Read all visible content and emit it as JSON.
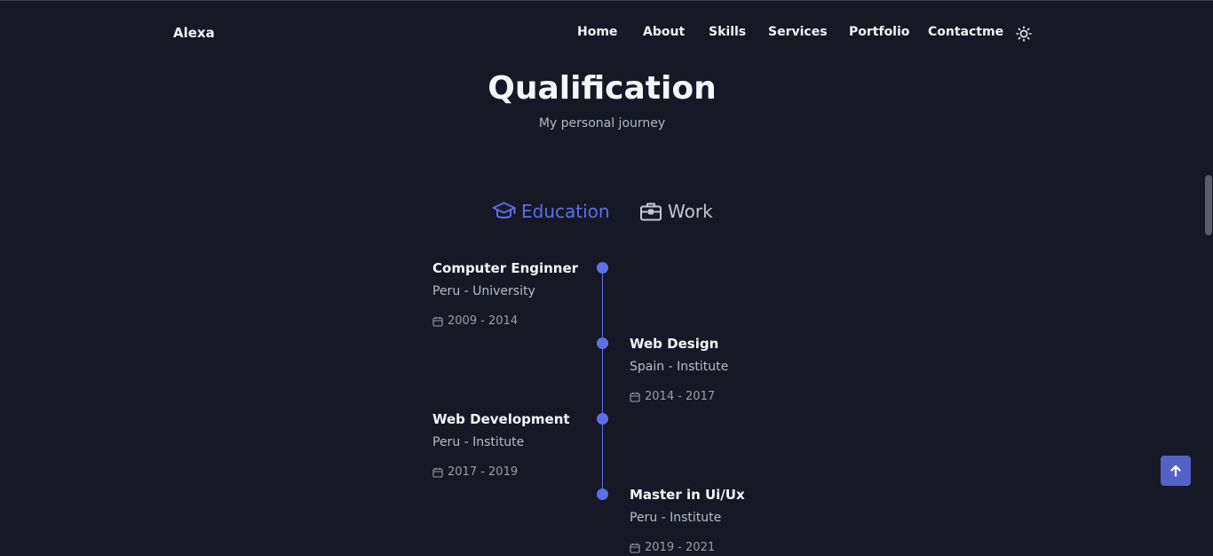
{
  "header": {
    "logo": "Alexa",
    "nav": [
      "Home",
      "About",
      "Skills",
      "Services",
      "Portfolio",
      "Contactme"
    ],
    "theme_icon": "sun-icon"
  },
  "section": {
    "title": "Qualification",
    "subtitle": "My personal journey"
  },
  "tabs": [
    {
      "label": "Education",
      "icon": "graduation-cap-icon",
      "active": true
    },
    {
      "label": "Work",
      "icon": "briefcase-icon",
      "active": false
    }
  ],
  "timeline": [
    {
      "title": "Computer Enginner",
      "subtitle": "Peru - University",
      "date": "2009 - 2014"
    },
    {
      "title": "Web Design",
      "subtitle": "Spain - Institute",
      "date": "2014 - 2017"
    },
    {
      "title": "Web Development",
      "subtitle": "Peru - Institute",
      "date": "2017 - 2019"
    },
    {
      "title": "Master in Ui/Ux",
      "subtitle": "Peru - Institute",
      "date": "2019 - 2021"
    }
  ],
  "colors": {
    "background": "#161826",
    "accent": "#5f6fe6",
    "text": "#f4f5f9",
    "muted": "#b8bbc8"
  },
  "scroll_up_icon": "arrow-up-icon"
}
